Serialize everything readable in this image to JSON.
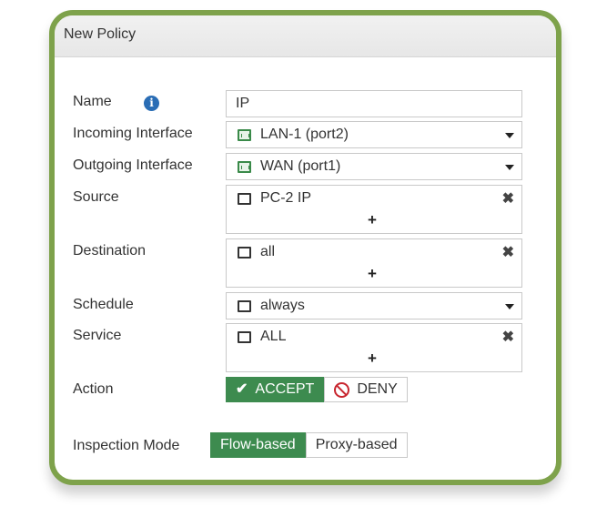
{
  "dialog": {
    "title": "New Policy"
  },
  "labels": {
    "name": "Name",
    "incoming": "Incoming Interface",
    "outgoing": "Outgoing Interface",
    "source": "Source",
    "destination": "Destination",
    "schedule": "Schedule",
    "service": "Service",
    "action": "Action",
    "inspection": "Inspection Mode"
  },
  "fields": {
    "name": "IP",
    "incoming": "LAN-1 (port2)",
    "outgoing": "WAN (port1)",
    "source": "PC-2 IP",
    "destination": "all",
    "schedule": "always",
    "service": "ALL"
  },
  "glyphs": {
    "info": "i",
    "remove": "✖",
    "add": "+",
    "check": "✔"
  },
  "action": {
    "options": [
      "ACCEPT",
      "DENY"
    ],
    "selected": "ACCEPT"
  },
  "inspection": {
    "options": [
      "Flow-based",
      "Proxy-based"
    ],
    "selected": "Flow-based"
  },
  "colors": {
    "frame": "#7ea24b",
    "accept": "#3d8b4f",
    "deny": "#c8262f",
    "info": "#2a6db5"
  }
}
